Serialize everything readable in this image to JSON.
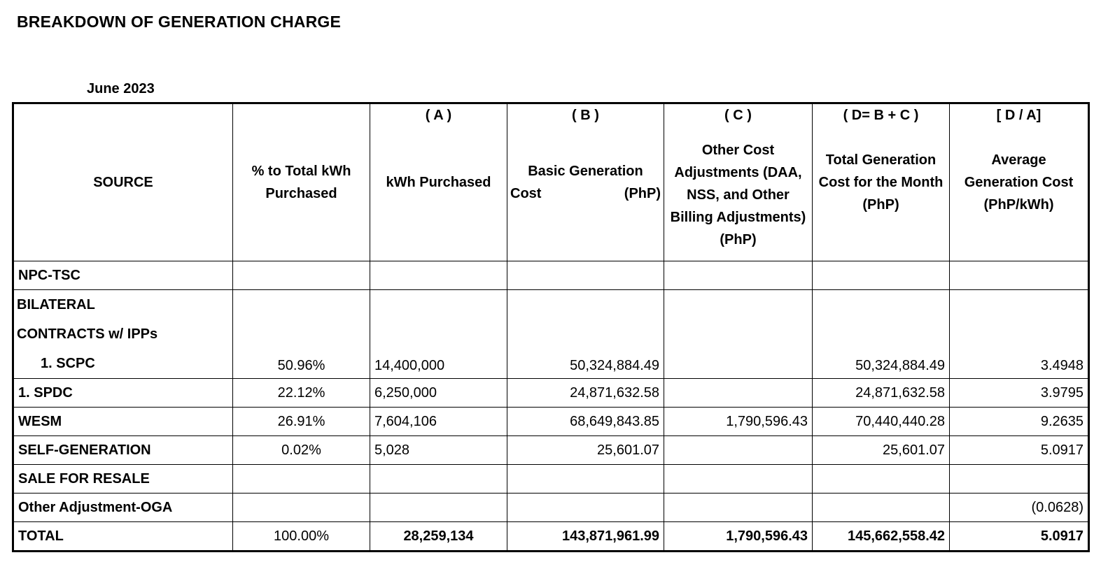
{
  "title": "BREAKDOWN OF GENERATION CHARGE",
  "period": "June 2023",
  "columns": {
    "source": "SOURCE",
    "pct": "% to Total kWh Purchased",
    "kwh_code": "( A )",
    "kwh": "kWh Purchased",
    "basic_code": "( B )",
    "basic_line1": "Basic Generation",
    "basic_line2a": "Cost",
    "basic_line2b": "(PhP)",
    "other_code": "( C )",
    "other": "Other Cost Adjustments (DAA, NSS, and Other Billing Adjustments) (PhP)",
    "total_code": "( D= B + C )",
    "total": "Total Generation Cost for the Month (PhP)",
    "avg_code": "[ D / A]",
    "avg": "Average Generation Cost (PhP/kWh)"
  },
  "rows": {
    "npc": {
      "source": "NPC-TSC",
      "pct": "",
      "kwh": "",
      "basic": "",
      "other": "",
      "total": "",
      "avg": ""
    },
    "bilateral": {
      "source_line1": "BILATERAL",
      "source_line2": "CONTRACTS w/ IPPs",
      "sub1": "1.  SCPC",
      "pct": "50.96%",
      "kwh": "14,400,000",
      "basic": "50,324,884.49",
      "other": "",
      "total": "50,324,884.49",
      "avg": "3.4948"
    },
    "spdc": {
      "source": "1.  SPDC",
      "pct": "22.12%",
      "kwh": "6,250,000",
      "basic": "24,871,632.58",
      "other": "",
      "total": "24,871,632.58",
      "avg": "3.9795"
    },
    "wesm": {
      "source": "WESM",
      "pct": "26.91%",
      "kwh": "7,604,106",
      "basic": "68,649,843.85",
      "other": "1,790,596.43",
      "total": "70,440,440.28",
      "avg": "9.2635"
    },
    "selfgen": {
      "source": "SELF-GENERATION",
      "pct": "0.02%",
      "kwh": "5,028",
      "basic": "25,601.07",
      "other": "",
      "total": "25,601.07",
      "avg": "5.0917"
    },
    "resale": {
      "source": "SALE FOR RESALE",
      "pct": "",
      "kwh": "",
      "basic": "",
      "other": "",
      "total": "",
      "avg": ""
    },
    "oga": {
      "source": "Other Adjustment-OGA",
      "pct": "",
      "kwh": "",
      "basic": "",
      "other": "",
      "total": "",
      "avg": "(0.0628)"
    },
    "total": {
      "source": "TOTAL",
      "pct": "100.00%",
      "kwh": "28,259,134",
      "basic": "143,871,961.99",
      "other": "1,790,596.43",
      "total": "145,662,558.42",
      "avg": "5.0917"
    }
  }
}
